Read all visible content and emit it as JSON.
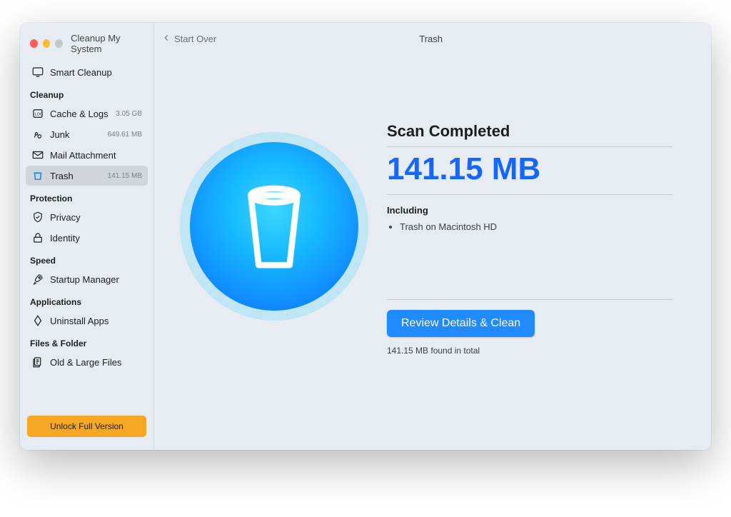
{
  "app": {
    "title": "Cleanup My System"
  },
  "sidebar": {
    "smart_cleanup": {
      "label": "Smart Cleanup"
    },
    "sections": {
      "cleanup": {
        "header": "Cleanup",
        "items": [
          {
            "name": "cache-logs",
            "label": "Cache & Logs",
            "value": "3.05 GB"
          },
          {
            "name": "junk",
            "label": "Junk",
            "value": "649.61 MB"
          },
          {
            "name": "mail-attachment",
            "label": "Mail Attachment",
            "value": ""
          },
          {
            "name": "trash",
            "label": "Trash",
            "value": "141.15 MB",
            "active": true
          }
        ]
      },
      "protection": {
        "header": "Protection",
        "items": [
          {
            "name": "privacy",
            "label": "Privacy"
          },
          {
            "name": "identity",
            "label": "Identity"
          }
        ]
      },
      "speed": {
        "header": "Speed",
        "items": [
          {
            "name": "startup-manager",
            "label": "Startup Manager"
          }
        ]
      },
      "applications": {
        "header": "Applications",
        "items": [
          {
            "name": "uninstall-apps",
            "label": "Uninstall Apps"
          }
        ]
      },
      "files_folder": {
        "header": "Files & Folder",
        "items": [
          {
            "name": "old-large-files",
            "label": "Old & Large Files"
          }
        ]
      }
    },
    "unlock_label": "Unlock Full Version"
  },
  "topbar": {
    "back_label": "Start Over",
    "title": "Trash"
  },
  "results": {
    "scan_title": "Scan Completed",
    "size": "141.15 MB",
    "including_label": "Including",
    "items": [
      "Trash on Macintosh HD"
    ],
    "review_label": "Review Details & Clean",
    "found_total": "141.15 MB found in total"
  }
}
